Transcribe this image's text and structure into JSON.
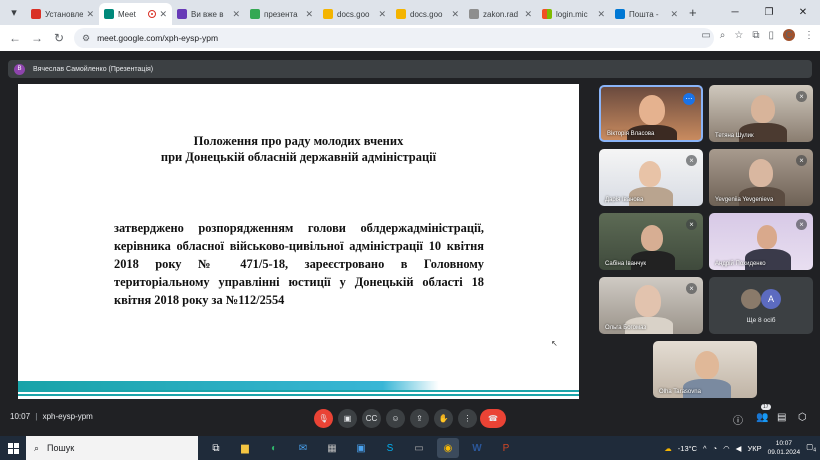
{
  "browser": {
    "tabs": [
      {
        "label": "Установлен",
        "fav_color": "#d93025",
        "active": false
      },
      {
        "label": "Meet",
        "fav_color": "#00897b",
        "active": true
      },
      {
        "label": "Ви вже в",
        "fav_color": "#673ab7",
        "active": false
      },
      {
        "label": "презента",
        "fav_color": "#34a853",
        "active": false
      },
      {
        "label": "docs.goo",
        "fav_color": "#f4b400",
        "active": false
      },
      {
        "label": "docs.goo",
        "fav_color": "#f4b400",
        "active": false
      },
      {
        "label": "zakon.rad",
        "fav_color": "#8e8e8e",
        "active": false
      },
      {
        "label": "login.mic",
        "fav_color": "#f25022",
        "active": false
      },
      {
        "label": "Пошта -",
        "fav_color": "#0078d4",
        "active": false
      }
    ],
    "url": "meet.google.com/xph-eysp-ypm",
    "profile_initial": "C"
  },
  "meet": {
    "presenter_initial": "B",
    "presenter_label": "Вячеслав Самойленко (Презентація)",
    "slide": {
      "title_line1": "Положення про раду молодих вчених",
      "title_line2": "при Донецькій обласній державній адміністрації",
      "body": "затверджено розпорядженням голови облдержадміністрації, керівника обласної військово-цивільної адміністрації 10 квітня 2018 року № 471/5-18, зареєстровано в Головному територіальному управлінні юстиції у Донецькій області 18 квітня 2018 року за №112/2554"
    },
    "participants": [
      {
        "name": "Вікторія Власова"
      },
      {
        "name": "Тетяна Шулик"
      },
      {
        "name": "Дарія Іванова"
      },
      {
        "name": "Yevgeniia Yevgenieva"
      },
      {
        "name": "Сабіна Іванчук"
      },
      {
        "name": "Андрій Похиденко"
      },
      {
        "name": "Ольга Богомаз"
      },
      {
        "name": "Ще 8 осіб",
        "avatar_letter": "A"
      },
      {
        "name": "Olha Tarasovna"
      }
    ],
    "time": "10:07",
    "meeting_code": "xph-eysp-ypm",
    "people_count": "17"
  },
  "taskbar": {
    "search_label": "Пошук",
    "weather": "-13°C",
    "lang": "УКР",
    "time": "10:07",
    "date": "09.01.2024",
    "notifications": "4"
  }
}
